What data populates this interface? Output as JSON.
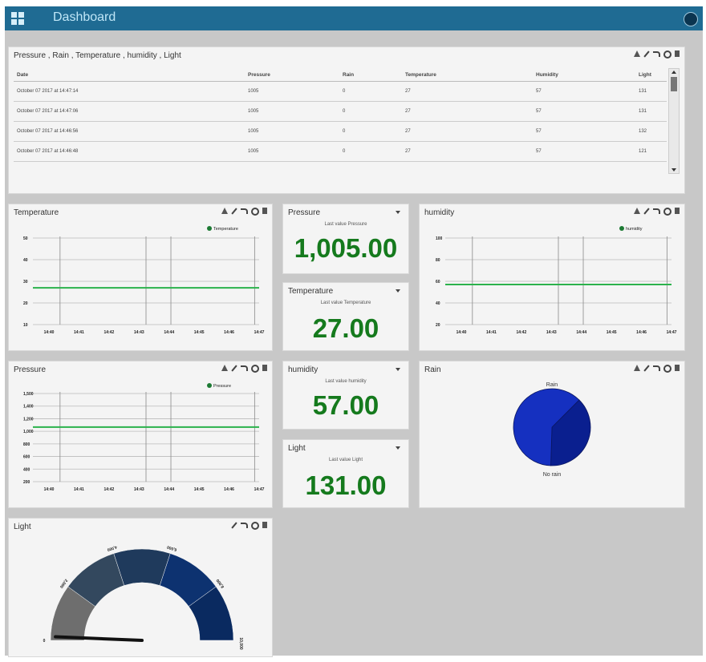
{
  "app": {
    "title": "Dashboard",
    "accent": "#1f6b93",
    "series_color": "#2bb24c",
    "value_color": "#157a1d"
  },
  "table_panel": {
    "title": "Pressure , Rain , Temperature , humidity , Light",
    "columns": [
      "Date",
      "Pressure",
      "Rain",
      "Temperature",
      "Humidity",
      "Light"
    ],
    "rows": [
      [
        "October 07 2017 at 14:47:14",
        "1005",
        "0",
        "27",
        "57",
        "131"
      ],
      [
        "October 07 2017 at 14:47:06",
        "1005",
        "0",
        "27",
        "57",
        "131"
      ],
      [
        "October 07 2017 at 14:46:56",
        "1005",
        "0",
        "27",
        "57",
        "132"
      ],
      [
        "October 07 2017 at 14:46:48",
        "1005",
        "0",
        "27",
        "57",
        "121"
      ]
    ]
  },
  "temperature_chart": {
    "title": "Temperature",
    "chart_data": {
      "type": "line",
      "x_ticks": [
        "14:40",
        "14:41",
        "14:42",
        "14:43",
        "14:44",
        "14:45",
        "14:46",
        "14:47"
      ],
      "y_ticks": [
        "50",
        "40",
        "30",
        "20",
        "10"
      ],
      "series": [
        {
          "name": "Temperature",
          "values": [
            27,
            27,
            27,
            27,
            27,
            27,
            27,
            27
          ]
        }
      ],
      "ylim": [
        10,
        50
      ],
      "legend": "top-right"
    }
  },
  "humidity_chart": {
    "title": "humidity",
    "chart_data": {
      "type": "line",
      "x_ticks": [
        "14:40",
        "14:41",
        "14:42",
        "14:43",
        "14:44",
        "14:45",
        "14:46",
        "14:47"
      ],
      "y_ticks": [
        "100",
        "80",
        "60",
        "40",
        "20"
      ],
      "series": [
        {
          "name": "humidity",
          "values": [
            57,
            57,
            57,
            57,
            57,
            57,
            57,
            57
          ]
        }
      ],
      "ylim": [
        20,
        100
      ],
      "legend": "top-right"
    }
  },
  "pressure_chart": {
    "title": "Pressure",
    "chart_data": {
      "type": "line",
      "x_ticks": [
        "14:40",
        "14:41",
        "14:42",
        "14:43",
        "14:44",
        "14:45",
        "14:46",
        "14:47"
      ],
      "y_ticks": [
        "1,500",
        "1,400",
        "1,200",
        "1,000",
        "800",
        "600",
        "400",
        "200"
      ],
      "series": [
        {
          "name": "Pressure",
          "values": [
            1005,
            1005,
            1005,
            1005,
            1005,
            1005,
            1005,
            1005
          ]
        }
      ],
      "ylim": [
        200,
        1500
      ],
      "legend": "top-right"
    }
  },
  "stat_pressure": {
    "title": "Pressure",
    "subtitle": "Last value Pressure",
    "value": "1,005.00"
  },
  "stat_temperature": {
    "title": "Temperature",
    "subtitle": "Last value Temperature",
    "value": "27.00"
  },
  "stat_humidity": {
    "title": "humidity",
    "subtitle": "Last value humidity",
    "value": "57.00"
  },
  "stat_light": {
    "title": "Light",
    "subtitle": "Last value Light",
    "value": "131.00"
  },
  "rain_chart": {
    "title": "Rain",
    "chart_data": {
      "type": "pie",
      "slices": [
        {
          "label": "Rain",
          "value": 38,
          "color": "#0a1f8f"
        },
        {
          "label": "No rain",
          "value": 62,
          "color": "#1530c0"
        }
      ]
    }
  },
  "light_gauge": {
    "title": "Light",
    "chart_data": {
      "type": "gauge",
      "value": 131,
      "min": "0",
      "max": "10,000",
      "ticks": [
        "2,000",
        "4,000",
        "6,000",
        "8,000"
      ]
    }
  }
}
